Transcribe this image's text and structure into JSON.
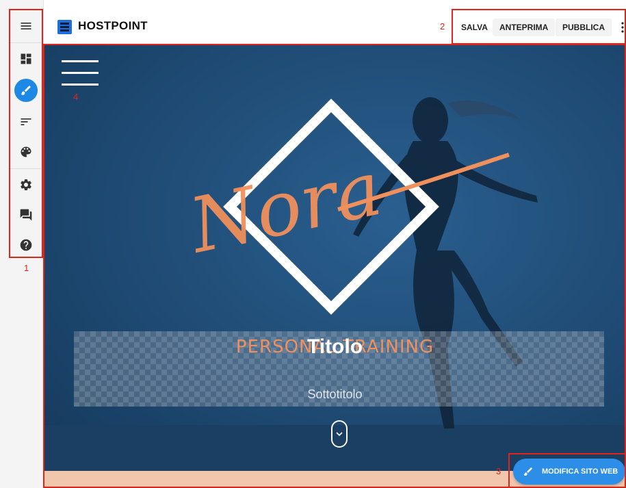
{
  "topbar": {
    "logo_text": "HOSTPOINT",
    "save_label": "SALVA",
    "preview_label": "ANTEPRIMA",
    "publish_label": "PUBBLICA"
  },
  "sidebar": {
    "items": [
      {
        "icon": "menu-icon"
      },
      {
        "icon": "dashboard-icon"
      },
      {
        "icon": "brush-icon",
        "active": true
      },
      {
        "icon": "sort-icon"
      },
      {
        "icon": "palette-icon"
      },
      {
        "icon": "settings-icon"
      },
      {
        "icon": "feedback-icon"
      },
      {
        "icon": "help-icon"
      }
    ]
  },
  "hero": {
    "brand_script": "Nora",
    "tagline": "PERSONAL TRAINING",
    "title": "Titolo",
    "subtitle": "Sottotitolo"
  },
  "fab": {
    "label": "MODIFICA SITO WEB"
  },
  "annotations": {
    "n1": "1",
    "n2": "2",
    "n3": "3",
    "n4": "4"
  },
  "colors": {
    "accent": "#1e88e5",
    "hero_bg": "#1f4d78",
    "brand_orange": "#f0905c",
    "annotation": "#e2231a"
  }
}
